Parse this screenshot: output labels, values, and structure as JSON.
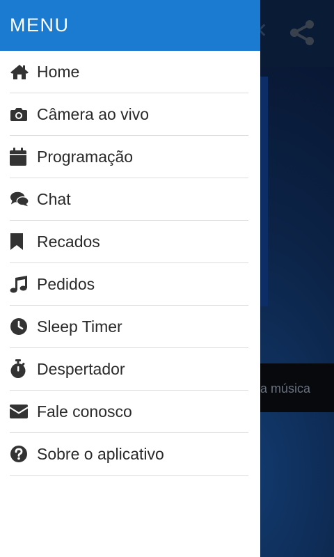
{
  "drawer": {
    "title": "MENU",
    "items": [
      {
        "label": "Home",
        "icon": "home-icon"
      },
      {
        "label": "Câmera ao vivo",
        "icon": "camera-icon"
      },
      {
        "label": "Programação",
        "icon": "calendar-icon"
      },
      {
        "label": "Chat",
        "icon": "chat-icon"
      },
      {
        "label": "Recados",
        "icon": "bookmark-icon"
      },
      {
        "label": "Pedidos",
        "icon": "music-note-icon"
      },
      {
        "label": "Sleep Timer",
        "icon": "clock-icon"
      },
      {
        "label": "Despertador",
        "icon": "stopwatch-icon"
      },
      {
        "label": "Fale conosco",
        "icon": "envelope-icon"
      },
      {
        "label": "Sobre o aplicativo",
        "icon": "question-circle-icon"
      }
    ]
  },
  "background": {
    "strip_text": "a música",
    "share_icon": "share-icon"
  },
  "colors": {
    "header": "#1a7bd0",
    "icon": "#333333",
    "text": "#2a2a2a",
    "divider": "#dcdcdc"
  }
}
